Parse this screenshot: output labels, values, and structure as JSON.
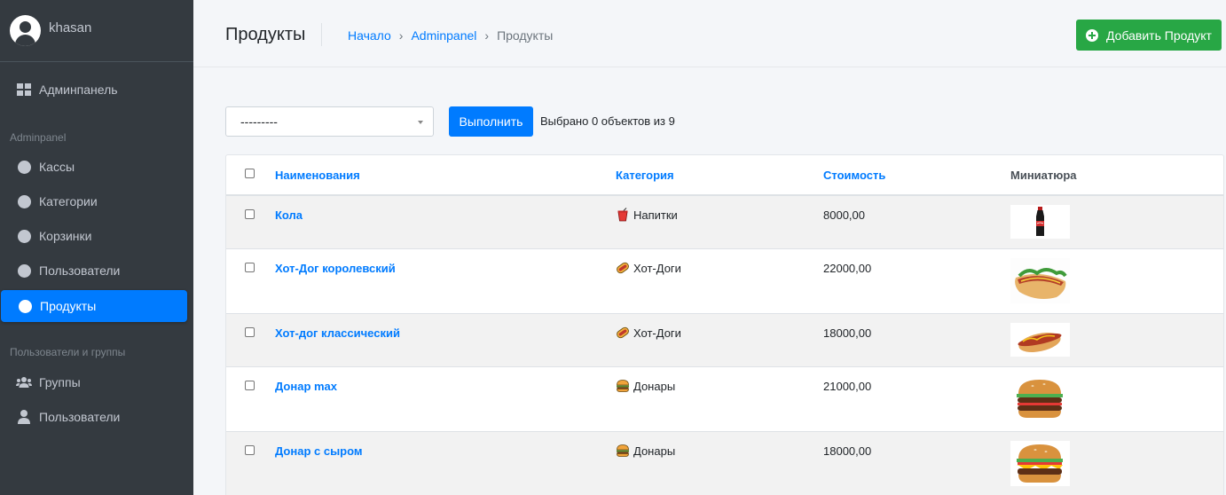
{
  "sidebar": {
    "user": {
      "name": "khasan"
    },
    "dashboard_label": "Админпанель",
    "section_admin": "Adminpanel",
    "admin_items": [
      {
        "label": "Кассы",
        "icon": "circle-icon"
      },
      {
        "label": "Категории",
        "icon": "circle-icon"
      },
      {
        "label": "Корзинки",
        "icon": "circle-icon"
      },
      {
        "label": "Пользователи",
        "icon": "circle-icon"
      },
      {
        "label": "Продукты",
        "icon": "circle-icon",
        "active": true
      }
    ],
    "section_users": "Пользователи и группы",
    "user_items": [
      {
        "label": "Группы",
        "icon": "users-icon"
      },
      {
        "label": "Пользователи",
        "icon": "user-icon"
      }
    ]
  },
  "header": {
    "title": "Продукты",
    "breadcrumb": [
      "Начало",
      "Adminpanel",
      "Продукты"
    ],
    "add_button": "Добавить Продукт"
  },
  "actions": {
    "select_value": "---------",
    "run_button": "Выполнить",
    "selected_text": "Выбрано 0 объектов из 9"
  },
  "table": {
    "columns": [
      "Наименования",
      "Категория",
      "Стоимость",
      "Миниатюра"
    ],
    "rows": [
      {
        "name": "Кола",
        "category": "Напитки",
        "category_icon": "drink-icon",
        "price": "8000,00",
        "thumb": "cola-bottle"
      },
      {
        "name": "Хот-Дог королевский",
        "category": "Хот-Доги",
        "category_icon": "hotdog-icon",
        "price": "22000,00",
        "thumb": "hotdog-royal"
      },
      {
        "name": "Хот-дог классический",
        "category": "Хот-Доги",
        "category_icon": "hotdog-icon",
        "price": "18000,00",
        "thumb": "hotdog-classic"
      },
      {
        "name": "Донар max",
        "category": "Донары",
        "category_icon": "burger-icon",
        "price": "21000,00",
        "thumb": "burger"
      },
      {
        "name": "Донар с сыром",
        "category": "Донары",
        "category_icon": "burger-icon",
        "price": "18000,00",
        "thumb": "cheeseburger"
      }
    ]
  },
  "colors": {
    "sidebar_bg": "#343a40",
    "primary": "#007bff",
    "success": "#28a745",
    "content_bg": "#f4f6f9"
  }
}
